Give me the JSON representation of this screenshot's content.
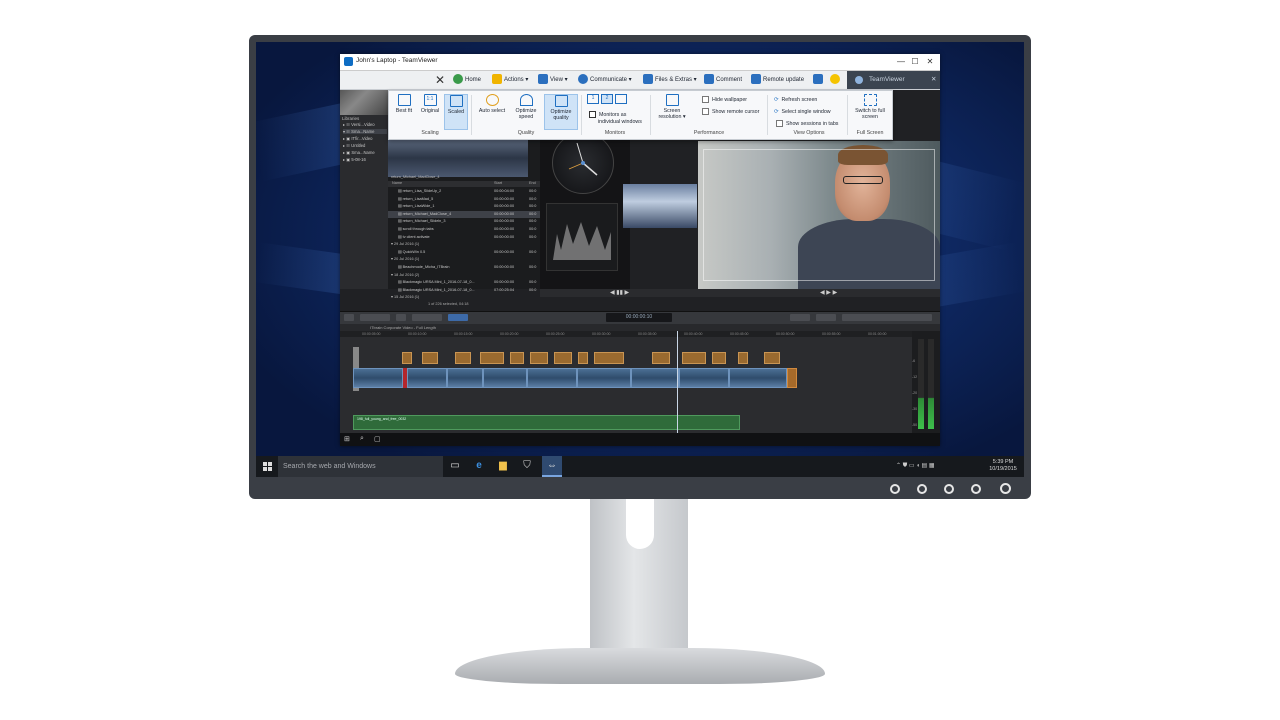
{
  "tv_window": {
    "title": "John's Laptop - TeamViewer",
    "brand": "TeamViewer",
    "controls": [
      "—",
      "☐",
      "✕"
    ]
  },
  "toolbar": {
    "items": [
      {
        "label": "Home",
        "icon": "home-icon"
      },
      {
        "label": "Actions ▾",
        "icon": "actions-bolt-icon"
      },
      {
        "label": "View ▾",
        "icon": "view-monitor-icon"
      },
      {
        "label": "Communicate ▾",
        "icon": "phone-icon"
      },
      {
        "label": "Files & Extras ▾",
        "icon": "folder-icon"
      },
      {
        "label": "Comment",
        "icon": "comment-icon"
      },
      {
        "label": "Remote update",
        "icon": "download-arrow-icon"
      }
    ]
  },
  "ribbon": {
    "scaling": {
      "group": "Scaling",
      "best_fit": "Best fit",
      "original": "Original",
      "scaled": "Scaled"
    },
    "quality": {
      "group": "Quality",
      "auto": "Auto select",
      "speed_1": "Optimize",
      "speed_2": "speed",
      "quality_1": "Optimize",
      "quality_2": "quality"
    },
    "monitors": {
      "group": "Monitors",
      "individual_1": "Monitors as",
      "individual_2": "individual windows"
    },
    "performance": {
      "group": "Performance",
      "resolution_1": "Screen",
      "resolution_2": "resolution ▾",
      "hide_wallpaper": "Hide wallpaper",
      "show_cursor": "Show remote cursor"
    },
    "view_options": {
      "group": "View Options",
      "refresh": "Refresh screen",
      "single_window": "Select single window",
      "sessions_tabs": "Show sessions in tabs"
    },
    "full_screen": {
      "group": "Full Screen",
      "switch_1": "Switch to full",
      "switch_2": "screen"
    }
  },
  "remote": {
    "libraries_label": "Libraries",
    "libraries": [
      "▸ ☷ Versi...Video",
      "▾ ☷ Sma...Name",
      "▸ ▣ ITfir...Video",
      "▸ ☷ Untitled",
      "▸ ▣ Sma...Name",
      "▸ ▣ 5-08-16"
    ],
    "browser_columns": {
      "name": "Name",
      "start": "Start",
      "end": "End"
    },
    "clip_label": "return_Michael_MadClose_4",
    "rows": [
      {
        "name": "▤ return_Lisa_SlideUp_2",
        "start": "00:00:04:00",
        "end": "00:0",
        "sel": false
      },
      {
        "name": "▤ return_LisaMad_5",
        "start": "00:00:00:00",
        "end": "00:0",
        "sel": false
      },
      {
        "name": "▤ return_LisaWide_1",
        "start": "00:00:00:00",
        "end": "00:0",
        "sel": false
      },
      {
        "name": "▤ return_Michael_MadClose_4",
        "start": "00:00:00:00",
        "end": "00:0",
        "sel": true
      },
      {
        "name": "▤ return_Michael_Slideln_3",
        "start": "00:00:00:00",
        "end": "00:0",
        "sel": false
      },
      {
        "name": "▤ scroll through tabs",
        "start": "00:00:00:00",
        "end": "00:0",
        "sel": false
      },
      {
        "name": "▤ tv client activate",
        "start": "00:00:00:00",
        "end": "00:0",
        "sel": false
      },
      {
        "name": "▾ 29 Jul 2016 (1)",
        "start": "",
        "end": "",
        "sel": false
      },
      {
        "name": "▤ QuickWin 0.5",
        "start": "00:00:00:00",
        "end": "00:0",
        "sel": false
      },
      {
        "name": "▾ 20 Jul 2016 (1)",
        "start": "",
        "end": "",
        "sel": false
      },
      {
        "name": "▤ Beachmode_Micha_ITBrain",
        "start": "00:00:00:00",
        "end": "00:0",
        "sel": false
      },
      {
        "name": "▾ 18 Jul 2016 (2)",
        "start": "",
        "end": "",
        "sel": false
      },
      {
        "name": "▤ Blackmagic URSA Mini_1_2016-07-18_0...",
        "start": "00:00:00:00",
        "end": "00:0",
        "sel": false
      },
      {
        "name": "▤ Blackmagic URSA Mini_1_2016-07-18_0...",
        "start": "07:00:25:04",
        "end": "00:0",
        "sel": false
      },
      {
        "name": "▾ 15 Jul 2016 (1)",
        "start": "",
        "end": "",
        "sel": false
      }
    ],
    "selection_status": "1 of 226 selected, 04:18",
    "timecode": "00:00:00:10",
    "timeline_title": "ITbrain Corporate Video - Full Length",
    "ruler_ticks": [
      "00:00:05:00",
      "00:00:10:00",
      "00:00:15:00",
      "00:00:20:00",
      "00:00:25:00",
      "00:00:30:00",
      "00:00:35:00",
      "00:00:40:00",
      "00:00:45:00",
      "00:00:50:00",
      "00:00:55:00",
      "00:01:00:00"
    ],
    "audio_clip": "198_full_young_and_free_0032",
    "meter_labels": [
      "-6",
      "-12",
      "-20",
      "-30",
      "-50"
    ]
  },
  "taskbar": {
    "search_placeholder": "Search the web and Windows",
    "time": "5:39 PM",
    "date": "10/19/2015"
  }
}
